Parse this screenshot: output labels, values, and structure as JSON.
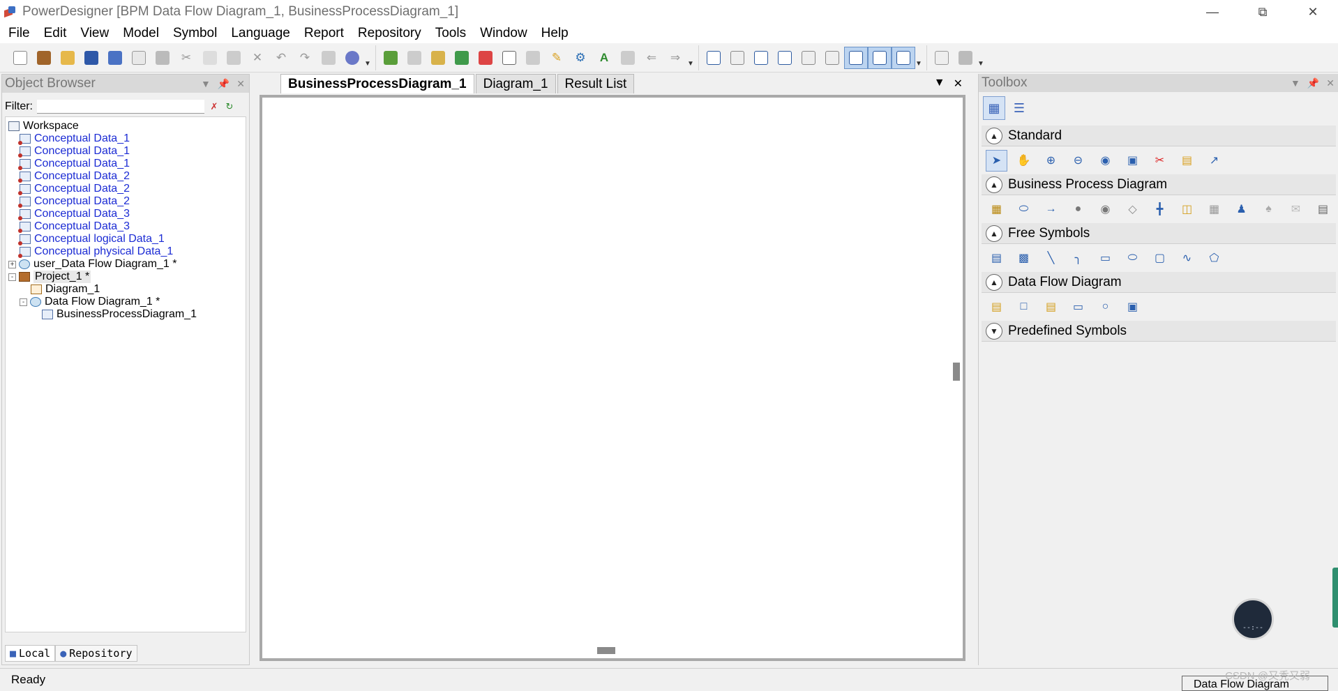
{
  "window": {
    "title": "PowerDesigner [BPM Data Flow Diagram_1, BusinessProcessDiagram_1]"
  },
  "menu": [
    "File",
    "Edit",
    "View",
    "Model",
    "Symbol",
    "Language",
    "Report",
    "Repository",
    "Tools",
    "Window",
    "Help"
  ],
  "object_browser": {
    "title": "Object Browser",
    "filter_label": "Filter:",
    "filter_value": "",
    "tree": [
      {
        "label": "Workspace",
        "level": 0
      },
      {
        "label": "Conceptual Data_1",
        "level": 1,
        "link": true
      },
      {
        "label": "Conceptual Data_1",
        "level": 1,
        "link": true
      },
      {
        "label": "Conceptual Data_1",
        "level": 1,
        "link": true
      },
      {
        "label": "Conceptual Data_2",
        "level": 1,
        "link": true
      },
      {
        "label": "Conceptual Data_2",
        "level": 1,
        "link": true
      },
      {
        "label": "Conceptual Data_2",
        "level": 1,
        "link": true
      },
      {
        "label": "Conceptual Data_3",
        "level": 1,
        "link": true
      },
      {
        "label": "Conceptual Data_3",
        "level": 1,
        "link": true
      },
      {
        "label": "Conceptual logical Data_1",
        "level": 1,
        "link": true
      },
      {
        "label": "Conceptual physical Data_1",
        "level": 1,
        "link": true
      },
      {
        "label": "user_Data Flow Diagram_1 *",
        "level": 1,
        "expander": "+"
      },
      {
        "label": "Project_1 *",
        "level": 1,
        "expander": "-"
      },
      {
        "label": "Diagram_1",
        "level": 2
      },
      {
        "label": "Data Flow Diagram_1 *",
        "level": 2,
        "expander": "-"
      },
      {
        "label": "BusinessProcessDiagram_1",
        "level": 3
      }
    ],
    "bottom_tabs": [
      "Local",
      "Repository"
    ]
  },
  "editor": {
    "tabs": [
      "BusinessProcessDiagram_1",
      "Diagram_1",
      "Result List"
    ],
    "active_tab": 0
  },
  "toolbox": {
    "title": "Toolbox",
    "sections": [
      {
        "label": "Standard",
        "expanded": true,
        "tools": [
          "pointer-icon",
          "hand-icon",
          "zoom-in-icon",
          "zoom-out-icon",
          "zoom-fit-icon",
          "open-package-icon",
          "cut-icon",
          "properties-icon",
          "link-icon"
        ]
      },
      {
        "label": "Business Process Diagram",
        "expanded": true,
        "tools": [
          "package-icon",
          "process-icon",
          "flow-icon",
          "start-icon",
          "end-icon",
          "decision-icon",
          "synchronization-icon",
          "resource-icon",
          "swimlane-icon",
          "role-icon",
          "role-association-icon",
          "message-format-icon",
          "document-icon"
        ]
      },
      {
        "label": "Free Symbols",
        "expanded": true,
        "tools": [
          "title-icon",
          "text-icon",
          "line-icon",
          "arc-icon",
          "rectangle-icon",
          "ellipse-icon",
          "rounded-rectangle-icon",
          "polyline-icon",
          "polygon-icon"
        ]
      },
      {
        "label": "Data Flow Diagram",
        "expanded": true,
        "tools": [
          "data-store-icon",
          "external-entity-icon",
          "split-merge-icon",
          "dfd-process-icon",
          "dfd-start-icon",
          "dfd-flow-icon"
        ]
      },
      {
        "label": "Predefined Symbols",
        "expanded": false,
        "tools": []
      }
    ]
  },
  "status": {
    "text": "Ready",
    "pane": "Data Flow Diagram"
  },
  "widget": {
    "text": "--:--"
  },
  "watermark": "CSDN @又秃又弱",
  "colors": {
    "link": "#1b2bd4",
    "panel_header": "#d9d9d9",
    "active_tab": "#ffffff"
  }
}
